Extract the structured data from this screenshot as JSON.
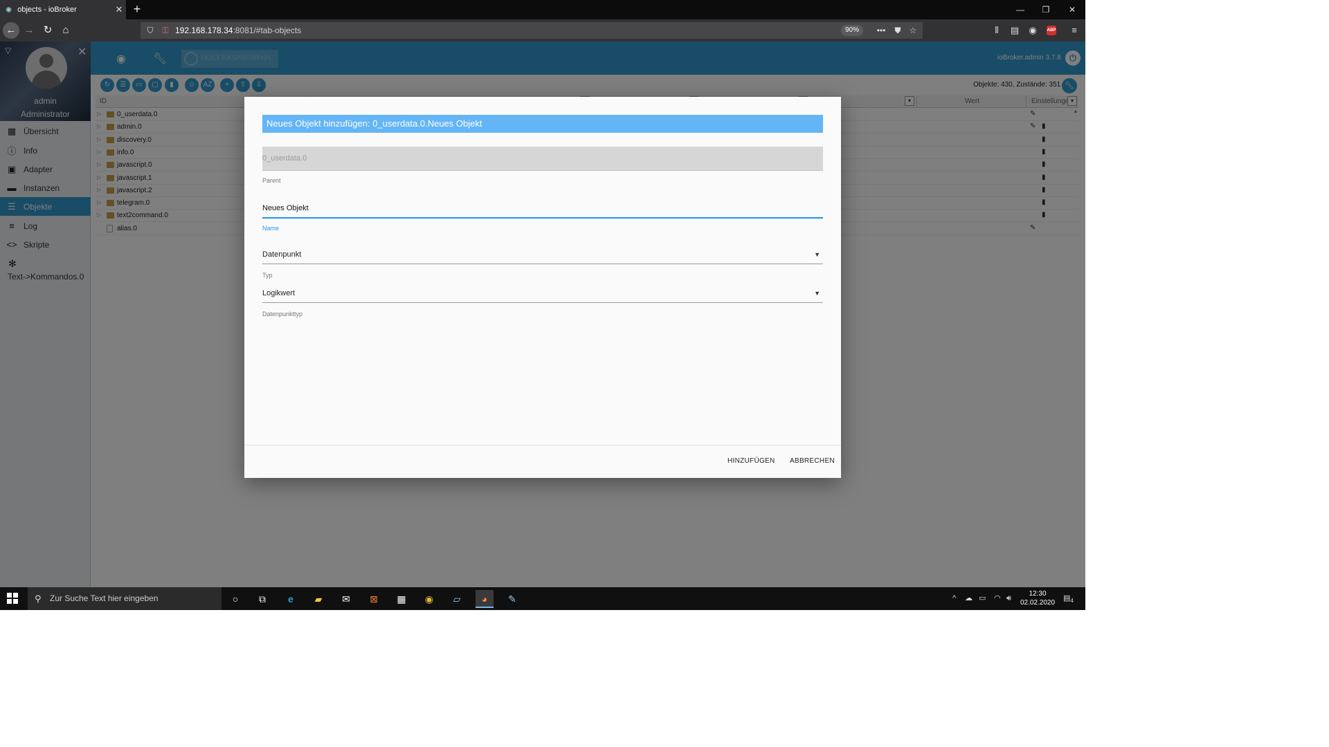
{
  "browser": {
    "tab_title": "objects - ioBroker",
    "tab_close": "✕",
    "new_tab": "+",
    "url_host": "192.168.178.34",
    "url_rest": ":8081/#tab-objects",
    "zoom": "90%",
    "abp": "ABP"
  },
  "sidebar": {
    "user": "admin",
    "role": "Administrator",
    "items": [
      {
        "label": "Übersicht",
        "icon": "grid-icon"
      },
      {
        "label": "Info",
        "icon": "info-icon"
      },
      {
        "label": "Adapter",
        "icon": "adapter-icon"
      },
      {
        "label": "Instanzen",
        "icon": "instances-icon"
      },
      {
        "label": "Objekte",
        "icon": "list-icon",
        "active": true
      },
      {
        "label": "Log",
        "icon": "log-icon"
      },
      {
        "label": "Skripte",
        "icon": "code-icon"
      }
    ],
    "extra_item": {
      "label": "Text->Kommandos.0",
      "icon": "snowflake-icon"
    }
  },
  "topbar": {
    "host_button": "HOST RASPBERRYPI",
    "version": "ioBroker.admin 3.7.8"
  },
  "toolbar": {
    "counts": "Objekte: 430, Zustände: 351"
  },
  "table": {
    "col_id": "ID",
    "col_value": "Wert",
    "col_settings": "Einstellungen",
    "rows": [
      {
        "id": "0_userdata.0",
        "type": "folder",
        "actions": "edit"
      },
      {
        "id": "admin.0",
        "type": "folder",
        "actions": "edit-delete"
      },
      {
        "id": "discovery.0",
        "type": "folder",
        "actions": "delete"
      },
      {
        "id": "info.0",
        "type": "folder",
        "actions": "delete"
      },
      {
        "id": "javascript.0",
        "type": "folder",
        "actions": "delete"
      },
      {
        "id": "javascript.1",
        "type": "folder",
        "actions": "delete"
      },
      {
        "id": "javascript.2",
        "type": "folder",
        "actions": "delete"
      },
      {
        "id": "telegram.0",
        "type": "folder",
        "actions": "delete"
      },
      {
        "id": "text2command.0",
        "type": "folder",
        "actions": "delete"
      },
      {
        "id": "alias.0",
        "type": "file",
        "actions": "edit"
      }
    ]
  },
  "dialog": {
    "title": "Neues Objekt hinzufügen: 0_userdata.0.Neues Objekt",
    "parent_value": "0_userdata.0",
    "parent_label": "Parent",
    "name_value": "Neues Objekt",
    "name_label": "Name",
    "type_value": "Datenpunkt",
    "type_label": "Typ",
    "datatype_value": "Logikwert",
    "datatype_label": "Datenpunkttyp",
    "add_button": "HINZUFÜGEN",
    "cancel_button": "ABBRECHEN"
  },
  "taskbar": {
    "search_placeholder": "Zur Suche Text hier eingeben",
    "time": "12:30",
    "date": "02.02.2020",
    "notifications": "4"
  },
  "colors": {
    "accent": "#3399cc",
    "dialog_title": "#64b5f6",
    "focus": "#2196f3"
  }
}
